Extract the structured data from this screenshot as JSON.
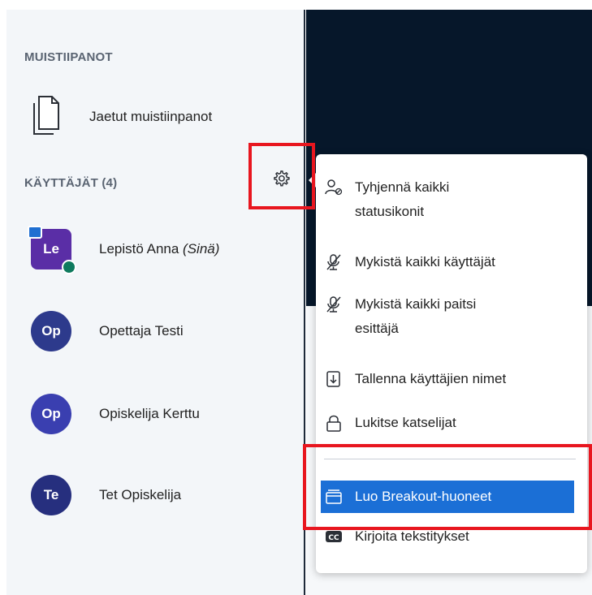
{
  "notes": {
    "section_title": "MUISTIIPANOT",
    "shared_notes_label": "Jaetut muistiinpanot"
  },
  "users": {
    "section_title": "KÄYTTÄJÄT (4)",
    "list": [
      {
        "initials": "Le",
        "name": "Lepistö Anna",
        "suffix": "(Sinä)"
      },
      {
        "initials": "Op",
        "name": "Opettaja Testi"
      },
      {
        "initials": "Op",
        "name": "Opiskelija Kerttu"
      },
      {
        "initials": "Te",
        "name": "Tet Opiskelija"
      }
    ]
  },
  "menu": {
    "items": [
      {
        "icon": "clear-status-icon",
        "line1": "Tyhjennä kaikki",
        "line2": "statusikonit"
      },
      {
        "icon": "mic-off-icon",
        "line1": "Mykistä kaikki käyttäjät"
      },
      {
        "icon": "mic-off-icon",
        "line1": "Mykistä kaikki paitsi",
        "line2": "esittäjä"
      },
      {
        "icon": "download-icon",
        "line1": "Tallenna käyttäjien nimet"
      },
      {
        "icon": "lock-icon",
        "line1": "Lukitse katselijat"
      },
      {
        "icon": "breakout-icon",
        "line1": "Luo Breakout-huoneet"
      },
      {
        "icon": "closed-captions-icon",
        "line1": "Kirjoita tekstitykset"
      }
    ]
  },
  "colors": {
    "accent": "#1b6fd6",
    "highlight": "#e8161f",
    "stage": "#06172a"
  }
}
